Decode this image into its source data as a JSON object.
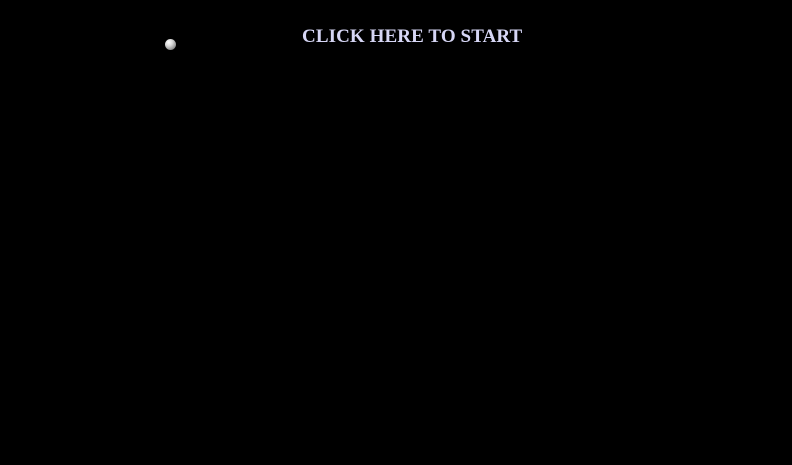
{
  "game": {
    "start_prompt": "CLICK HERE TO START"
  },
  "colors": {
    "background": "#000000",
    "prompt_text": "#d6d6f5",
    "ball": "#c8c8c8"
  },
  "icons": {
    "ball": "ball-icon"
  }
}
